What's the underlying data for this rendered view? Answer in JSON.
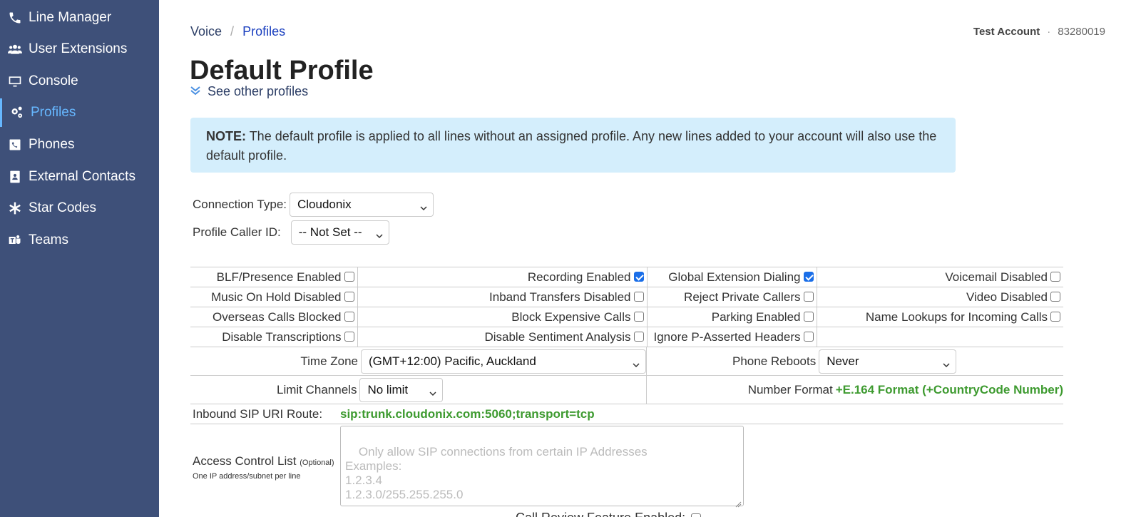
{
  "sidebar": {
    "items": [
      {
        "label": "Line Manager",
        "icon": "phone-icon"
      },
      {
        "label": "User Extensions",
        "icon": "users-icon"
      },
      {
        "label": "Console",
        "icon": "monitor-icon"
      },
      {
        "label": "Profiles",
        "icon": "gears-icon",
        "active": true
      },
      {
        "label": "Phones",
        "icon": "phone-square-icon"
      },
      {
        "label": "External Contacts",
        "icon": "contact-book-icon"
      },
      {
        "label": "Star Codes",
        "icon": "asterisk-icon"
      },
      {
        "label": "Teams",
        "icon": "teams-icon"
      }
    ],
    "accent": "#3e5079",
    "active_color": "#66b7ff"
  },
  "breadcrumb": {
    "root": "Voice",
    "separator": "/",
    "current": "Profiles"
  },
  "account": {
    "name": "Test Account",
    "separator": "·",
    "id": "83280019"
  },
  "page": {
    "title": "Default Profile",
    "see_other": "See other profiles"
  },
  "note": {
    "label": "NOTE:",
    "text": "The default profile is applied to all lines without an assigned profile. Any new lines added to your account will also use the default profile."
  },
  "form": {
    "connection_type": {
      "label": "Connection Type:",
      "value": "Cloudonix"
    },
    "profile_caller_id": {
      "label": "Profile Caller ID:",
      "value": "-- Not Set --"
    }
  },
  "options": {
    "row1": [
      {
        "label": "BLF/Presence Enabled",
        "checked": false
      },
      {
        "label": "Recording Enabled",
        "checked": true
      },
      {
        "label": "Global Extension Dialing",
        "checked": true
      },
      {
        "label": "Voicemail Disabled",
        "checked": false
      }
    ],
    "row2": [
      {
        "label": "Music On Hold Disabled",
        "checked": false
      },
      {
        "label": "Inband Transfers Disabled",
        "checked": false
      },
      {
        "label": "Reject Private Callers",
        "checked": false
      },
      {
        "label": "Video Disabled",
        "checked": false
      }
    ],
    "row3": [
      {
        "label": "Overseas Calls Blocked",
        "checked": false
      },
      {
        "label": "Block Expensive Calls",
        "checked": false
      },
      {
        "label": "Parking Enabled",
        "checked": false
      },
      {
        "label": "Name Lookups for Incoming Calls",
        "checked": false
      }
    ],
    "row4": [
      {
        "label": "Disable Transcriptions",
        "checked": false
      },
      {
        "label": "Disable Sentiment Analysis",
        "checked": false
      },
      {
        "label": "Ignore P-Asserted Headers",
        "checked": false
      }
    ]
  },
  "settings": {
    "time_zone": {
      "label": "Time Zone",
      "value": "(GMT+12:00) Pacific, Auckland"
    },
    "phone_reboots": {
      "label": "Phone Reboots",
      "value": "Never"
    },
    "limit_channels": {
      "label": "Limit Channels",
      "value": "No limit"
    },
    "number_format": {
      "label": "Number Format",
      "value": "+E.164 Format (+CountryCode Number)"
    },
    "inbound_sip": {
      "label": "Inbound SIP URI Route:",
      "value": "sip:trunk.cloudonix.com:5060;transport=tcp"
    },
    "acl": {
      "label": "Access Control List",
      "optional": "(Optional)",
      "hint": "One IP address/subnet per line",
      "placeholder": "Only allow SIP connections from certain IP Addresses\nExamples:\n1.2.3.4\n1.2.3.0/255.255.255.0"
    },
    "call_review": {
      "label": "Call Review Feature Enabled:"
    }
  },
  "colors": {
    "green": "#3d9a2f",
    "note_bg": "#d4eefc",
    "link": "#1a3fbf"
  }
}
